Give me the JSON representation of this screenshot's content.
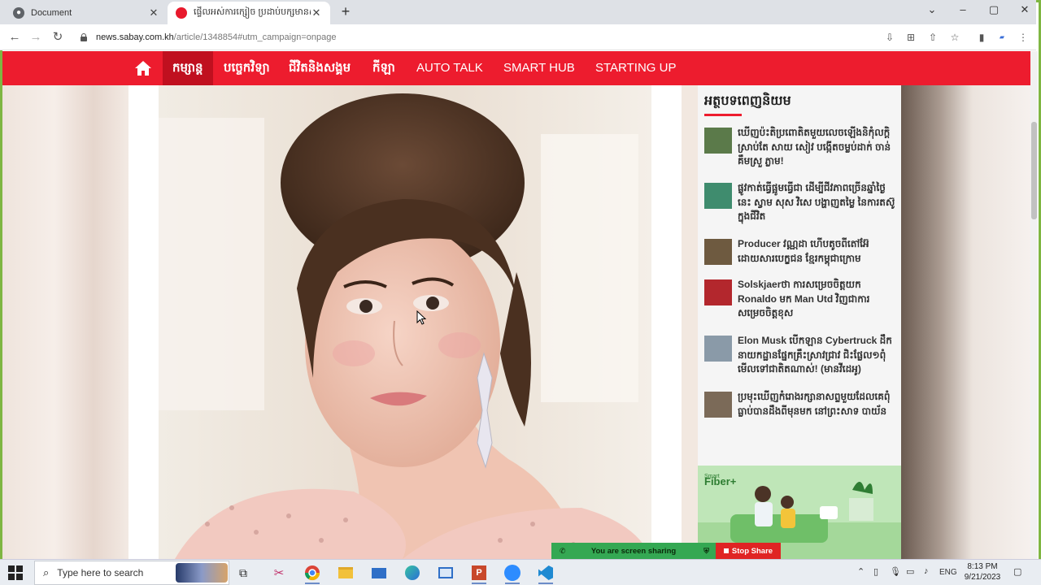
{
  "browser": {
    "tabs": [
      {
        "title": "Document",
        "favicon": "globe-icon",
        "active": false
      },
      {
        "title": "ផ្ទើលអស់ការក្សៀច ប្រដាប់បក្សមានស…",
        "favicon": "sabay-logo-icon",
        "active": true
      }
    ],
    "url_host": "news.sabay.com.kh",
    "url_rest": "/article/1348854#utm_campaign=onpage"
  },
  "site_nav": {
    "items": [
      {
        "label": "កម្សាន្ត",
        "active": true
      },
      {
        "label": "បច្ចេកវិទ្យា",
        "active": false
      },
      {
        "label": "ជីវិតនិងសង្គម",
        "active": false
      },
      {
        "label": "កីឡា",
        "active": false
      },
      {
        "label": "AUTO TALK",
        "active": false
      },
      {
        "label": "SMART HUB",
        "active": false
      },
      {
        "label": "STARTING UP",
        "active": false
      }
    ],
    "accent_color": "#ed1c2e"
  },
  "sidebar": {
    "title": "អត្ថបទពេញនិយម",
    "items": [
      {
        "text": "ឃើញប៉ះតិប្រពោតិតមួយលេចឡើងនិកុំលក្ដិ ស្រាប់តែ សាយ សៀវ បង្កើតចម្លប់ដាក់ ចាន់ គឹមស្រួ ភ្លាម!",
        "thumb": "#5b7a4a"
      },
      {
        "text": "ផ្លូវកាត់ធ្វើផ្អូមធ្វើជា ដើម្បីជីវភាពច្រើនឆ្នាំថ្ងៃនេះ ស្វាម សុស វិសេ បង្ហាញតម្លៃ នៃការតស៊ូក្នុងជីវិត",
        "thumb": "#3f8c6e"
      },
      {
        "text": "Producer វណ្ណដា ហើបតូចពីតៅអ៊ែ ដោយសារបេក្ខជន ខ្មែរកម្ពុជាក្រោម",
        "thumb": "#6e5a40"
      },
      {
        "text": "Solskjaerថា ការសម្រេចចិត្តយក Ronaldo មក Man Utd វិញជាការសម្រេចចិត្តខុស",
        "thumb": "#b3272d"
      },
      {
        "text": "Elon Musk បើកឡាន Cybertruck ដឹកនាយកដ្ឋានផ្នែកគ្រឹះស្រាវជ្រាវ ជិះផ្លែល១ពុំមើលទៅជាតិតណាស់! (មានវីដេអូ)",
        "thumb": "#8a9aa8"
      },
      {
        "text": "ប្រមុះឃើញកំរោងរក្សានាសព្ទមួយដែលគេពុំធ្លាប់បានដឹងពីមុនមក នៅព្រះសាទ បាយ័ន",
        "thumb": "#7b6a58"
      }
    ]
  },
  "ad": {
    "brand": "Fiber+",
    "brand_small": "Smart"
  },
  "screen_share": {
    "status": "You are screen sharing",
    "stop_label": "Stop Share"
  },
  "taskbar": {
    "search_placeholder": "Type here to search",
    "lang": "ENG",
    "time": "8:13 PM",
    "date": "9/21/2023"
  }
}
